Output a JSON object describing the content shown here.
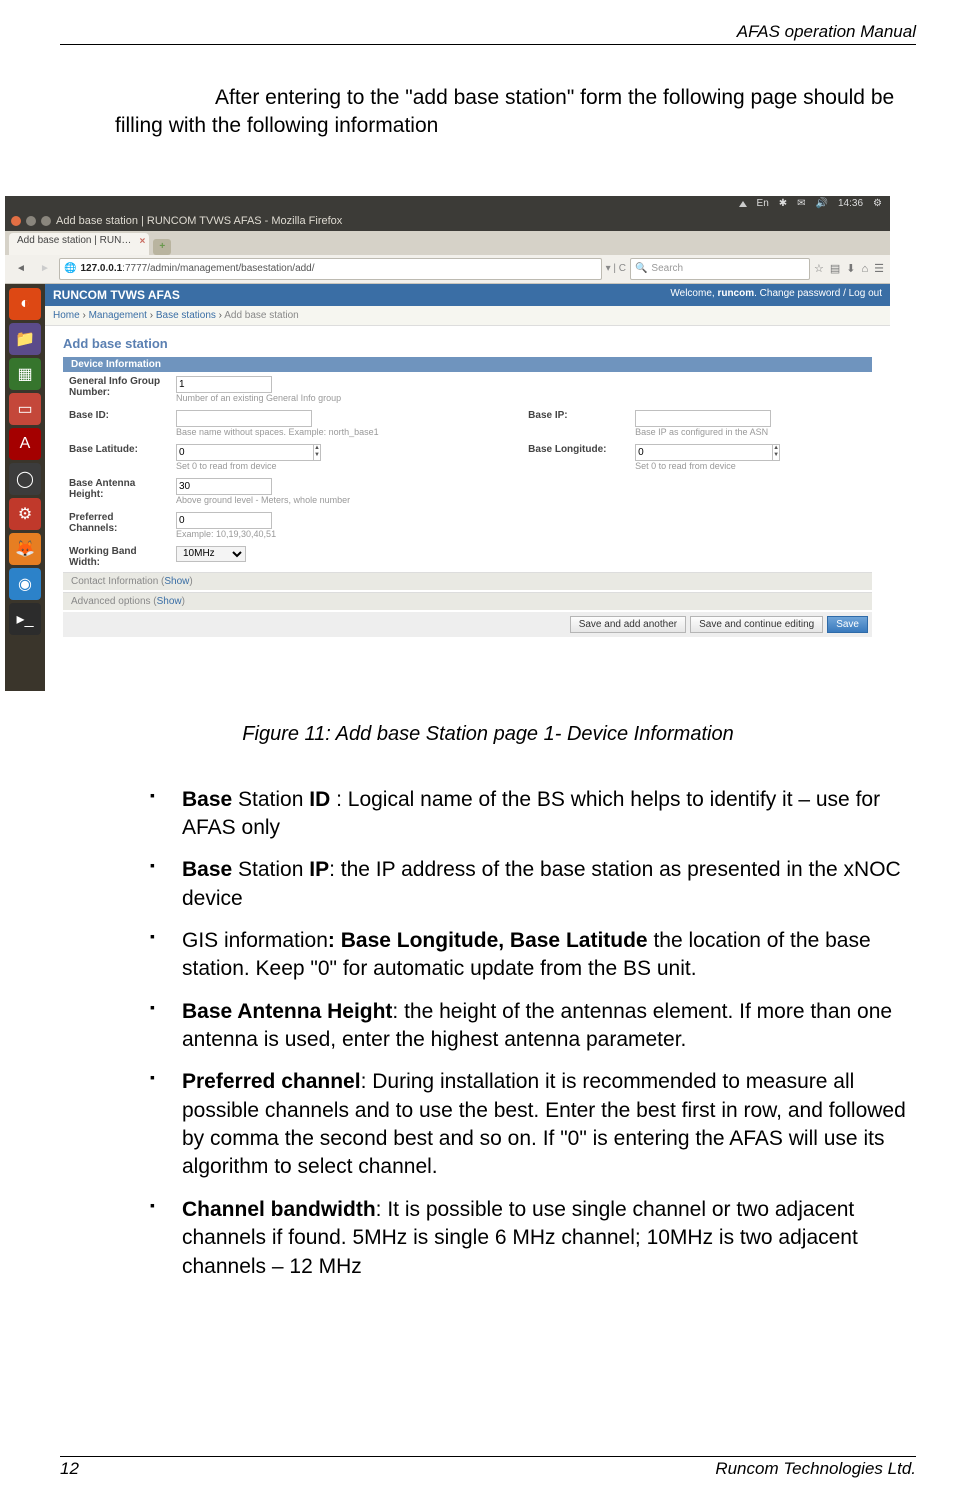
{
  "runningHead": "AFAS operation Manual",
  "introText": "After entering to the \"add base station\" form the following page should be filling with the following information",
  "osPanel": {
    "icons": [
      "⏸",
      "En",
      "✱",
      "✉",
      "🔊",
      "14:36",
      "⚙"
    ]
  },
  "window": {
    "title": "Add base station | RUNCOM TVWS AFAS - Mozilla Firefox",
    "tabLabel": "Add base station | RUN…",
    "url_prefix": "127.0.0.1",
    "url_rest": ":7777/admin/management/basestation/add/",
    "searchPlaceholder": "Search"
  },
  "app": {
    "brand": "RUNCOM TVWS AFAS",
    "welcomePrefix": "Welcome, ",
    "welcomeUser": "runcom",
    "welcomeSuffix": ". Change password / Log out",
    "breadcrumb": [
      "Home",
      "Management",
      "Base stations",
      "Add base station"
    ],
    "formTitle": "Add base station",
    "sectionDevice": "Device Information",
    "fields": {
      "generalInfo": {
        "label": "General Info Group Number:",
        "value": "1",
        "help": "Number of an existing General Info group"
      },
      "baseId": {
        "label": "Base ID:",
        "help": "Base name without spaces. Example: north_base1"
      },
      "baseIp": {
        "label": "Base IP:",
        "help": "Base IP as configured in the ASN"
      },
      "baseLat": {
        "label": "Base Latitude:",
        "value": "0",
        "help": "Set 0 to read from device"
      },
      "baseLon": {
        "label": "Base Longitude:",
        "value": "0",
        "help": "Set 0 to read from device"
      },
      "antHeight": {
        "label": "Base Antenna Height:",
        "value": "30",
        "help": "Above ground level - Meters, whole number"
      },
      "prefCh": {
        "label": "Preferred Channels:",
        "value": "0",
        "help": "Example: 10,19,30,40,51"
      },
      "bandwidth": {
        "label": "Working Band Width:",
        "value": "10MHz"
      }
    },
    "collapsedContact": "Contact Information",
    "collapsedAdvanced": "Advanced options",
    "showLabel": "Show",
    "btnSaveAddAnother": "Save and add another",
    "btnSaveContinue": "Save and continue editing",
    "btnSave": "Save"
  },
  "figCaption": "Figure 11: Add base Station page 1- Device Information",
  "bullets": [
    {
      "html": "<b>Base</b> Station <b>ID</b> : Logical name of the BS which helps to identify it – use for AFAS only"
    },
    {
      "html": "<b>Base</b> Station <b>IP</b>: the IP address of the base station as presented in the xNOC device"
    },
    {
      "html": "GIS information<b>: Base Longitude, Base Latitude</b> the location of the base station. Keep \"0\" for automatic update from the BS unit."
    },
    {
      "html": "<b>Base Antenna Height</b>: the height of the antennas element. If more than one antenna is used, enter the highest antenna parameter."
    },
    {
      "html": "<b>Preferred channel</b>:  During installation it is recommended to measure all possible channels and to use the best. Enter the best first in row, and followed by comma the second best and so on. If \"0\" is entering the AFAS will use its algorithm to select channel."
    },
    {
      "html": "<b>Channel bandwidth</b>: It is possible to use single channel or two adjacent channels if found. 5MHz is single 6 MHz channel; 10MHz is two adjacent channels – 12 MHz"
    }
  ],
  "pageNumber": "12",
  "footerRight": "Runcom Technologies Ltd."
}
